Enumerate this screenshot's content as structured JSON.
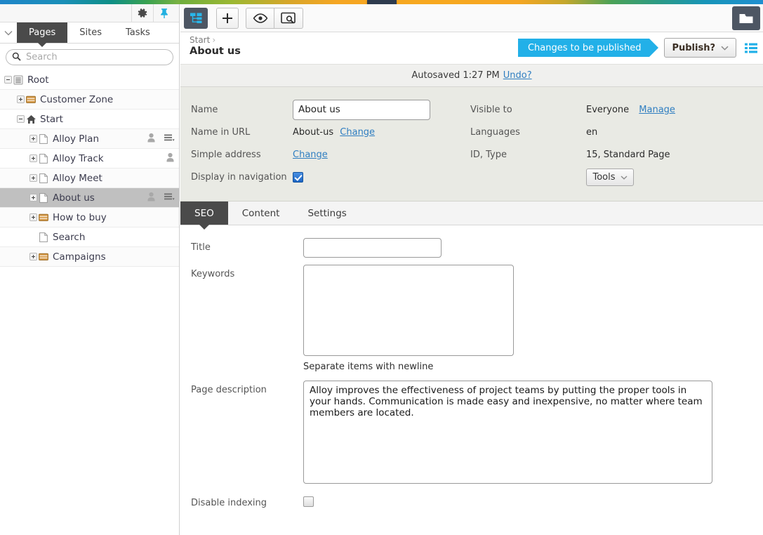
{
  "left_panel": {
    "toolbar": {
      "settings_icon": "gear-icon",
      "pin_icon": "pin-icon"
    },
    "tabs": [
      {
        "label": "Pages",
        "active": true
      },
      {
        "label": "Sites",
        "active": false
      },
      {
        "label": "Tasks",
        "active": false
      }
    ],
    "search": {
      "placeholder": "Search",
      "value": "",
      "icon": "search-icon"
    },
    "tree": [
      {
        "label": "Root",
        "indent": 0,
        "icon": "root-icon",
        "expander": "minus",
        "person": false,
        "menu": false,
        "selected": false
      },
      {
        "label": "Customer Zone",
        "indent": 1,
        "icon": "folder-icon",
        "expander": "plus",
        "person": false,
        "menu": false,
        "selected": false
      },
      {
        "label": "Start",
        "indent": 1,
        "icon": "home-icon",
        "expander": "minus",
        "person": false,
        "menu": false,
        "selected": false
      },
      {
        "label": "Alloy Plan",
        "indent": 2,
        "icon": "page-icon",
        "expander": "plus",
        "person": true,
        "menu": true,
        "selected": false
      },
      {
        "label": "Alloy Track",
        "indent": 2,
        "icon": "page-icon",
        "expander": "plus",
        "person": true,
        "menu": false,
        "selected": false
      },
      {
        "label": "Alloy Meet",
        "indent": 2,
        "icon": "page-icon",
        "expander": "plus",
        "person": false,
        "menu": false,
        "selected": false
      },
      {
        "label": "About us",
        "indent": 2,
        "icon": "page-icon",
        "expander": "plus",
        "person": true,
        "menu": true,
        "selected": true
      },
      {
        "label": "How to buy",
        "indent": 2,
        "icon": "folder-icon",
        "expander": "plus",
        "person": false,
        "menu": false,
        "selected": false
      },
      {
        "label": "Search",
        "indent": 2,
        "icon": "page-icon",
        "expander": "none",
        "person": false,
        "menu": false,
        "selected": false
      },
      {
        "label": "Campaigns",
        "indent": 2,
        "icon": "folder-icon",
        "expander": "plus",
        "person": false,
        "menu": false,
        "selected": false
      }
    ]
  },
  "main_toolbar": {
    "structure_icon": "sitemap-icon",
    "add_icon": "plus-icon",
    "view_icon": "eye-icon",
    "preview_icon": "preview-icon",
    "corner_icon": "folder-dark-icon"
  },
  "breadcrumb": {
    "parent": "Start",
    "separator": "›",
    "current": "About us"
  },
  "publish": {
    "status_label": "Changes to be published",
    "button_label": "Publish?",
    "caret_icon": "chevron-down-icon",
    "list_icon": "list-icon",
    "accent_color": "#22b0e8"
  },
  "autosave": {
    "text": "Autosaved 1:27 PM",
    "undo_label": "Undo?"
  },
  "properties": {
    "name_label": "Name",
    "name_value": "About us",
    "name_placeholder": "",
    "url_label": "Name in URL",
    "url_value": "About-us",
    "url_change_label": "Change",
    "simple_address_label": "Simple address",
    "simple_address_change_label": "Change",
    "display_nav_label": "Display in navigation",
    "display_nav_checked": true,
    "visible_to_label": "Visible to",
    "visible_to_value": "Everyone",
    "manage_label": "Manage",
    "languages_label": "Languages",
    "languages_value": "en",
    "id_type_label": "ID, Type",
    "id_type_value": "15, Standard Page",
    "tools_label": "Tools"
  },
  "tabs": [
    {
      "label": "SEO",
      "active": true
    },
    {
      "label": "Content",
      "active": false
    },
    {
      "label": "Settings",
      "active": false
    }
  ],
  "seo_form": {
    "title_label": "Title",
    "title_value": "",
    "keywords_label": "Keywords",
    "keywords_value": "",
    "keywords_hint": "Separate items with newline",
    "description_label": "Page description",
    "description_value": "Alloy improves the effectiveness of project teams by putting the proper tools in your hands. Communication is made easy and inexpensive, no matter where team members are located.",
    "disable_indexing_label": "Disable indexing",
    "disable_indexing_checked": false
  }
}
